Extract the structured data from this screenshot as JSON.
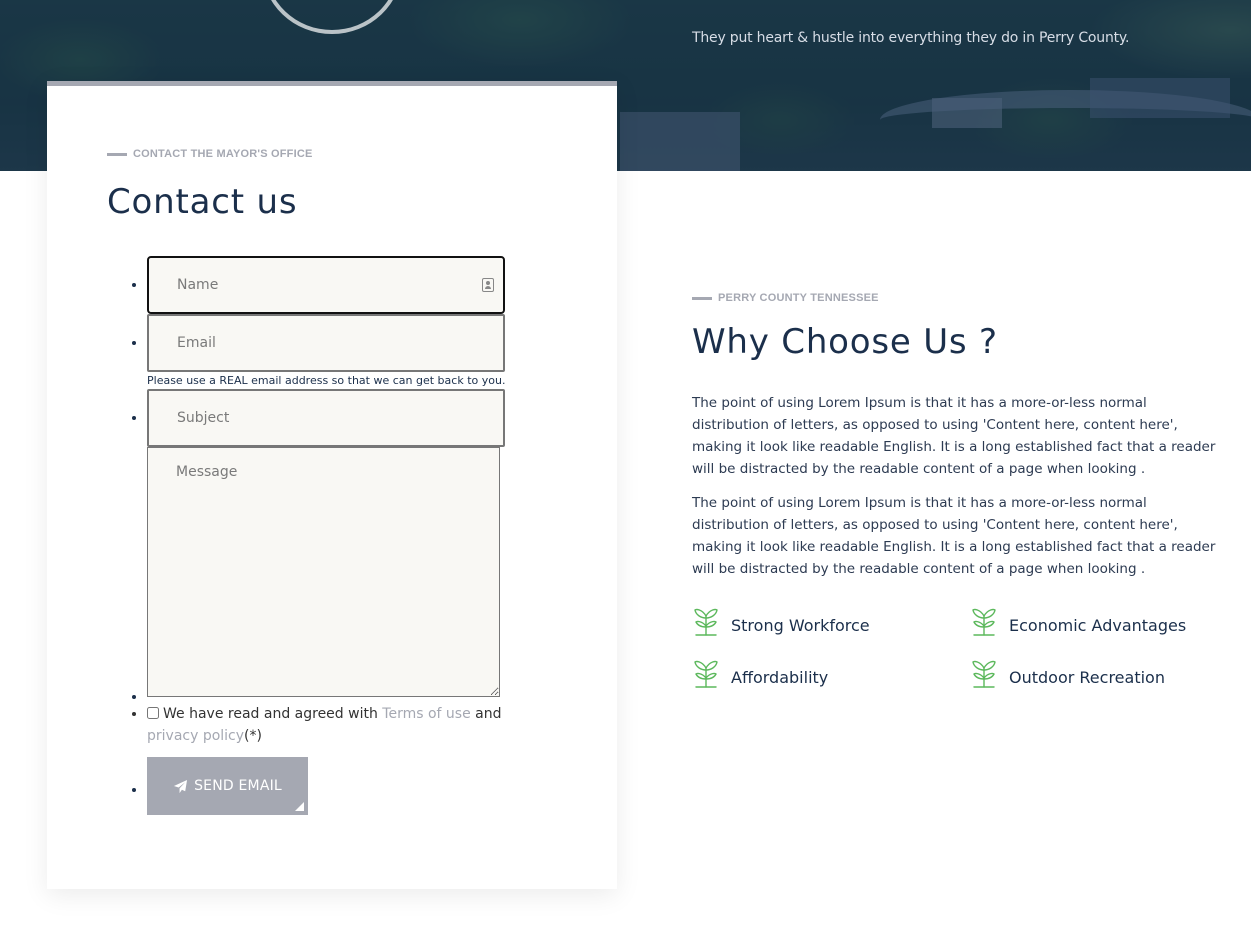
{
  "hero": {
    "tagline": "They put heart & hustle into everything they do in Perry County."
  },
  "contact": {
    "eyebrow": "CONTACT THE MAYOR'S OFFICE",
    "title": "Contact us",
    "name_placeholder": "Name",
    "email_placeholder": "Email",
    "email_hint": "Please use a REAL email address so that we can get back to you.",
    "subject_placeholder": "Subject",
    "message_placeholder": "Message",
    "agree_prefix": "We have read and agreed with",
    "terms_link": "Terms of use",
    "agree_and": "and",
    "privacy_link": "privacy policy",
    "required_mark": "(*)",
    "send_label": "SEND EMAIL"
  },
  "why": {
    "eyebrow": "PERRY COUNTY TENNESSEE",
    "title": "Why Choose Us ?",
    "paragraphs": [
      "The point of using Lorem Ipsum is that it has a more-or-less normal distribution of letters, as opposed to using 'Content here, content here', making it look like readable English. It is a long established fact that a reader will be distracted by the readable content of a page when looking .",
      "The point of using Lorem Ipsum is that it has a more-or-less normal distribution of letters, as opposed to using 'Content here, content here', making it look like readable English. It is a long established fact that a reader will be distracted by the readable content of a page when looking ."
    ],
    "features": [
      {
        "label": "Strong Workforce",
        "icon": "sprout-icon"
      },
      {
        "label": "Economic Advantages",
        "icon": "sprout-icon"
      },
      {
        "label": "Affordability",
        "icon": "sprout-icon"
      },
      {
        "label": "Outdoor Recreation",
        "icon": "sprout-icon"
      }
    ]
  },
  "colors": {
    "accent_gray": "#a5a8b2",
    "navy": "#1b2f4b",
    "sprout_green": "#5cb85c",
    "field_bg": "#f9f8f4"
  }
}
